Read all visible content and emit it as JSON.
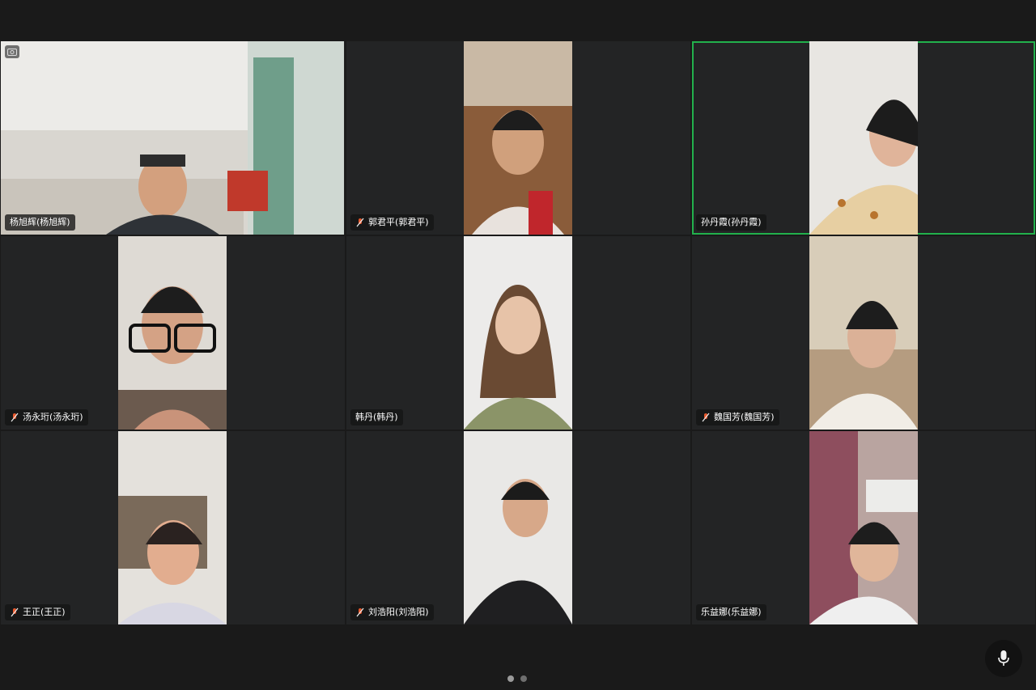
{
  "participants": [
    {
      "name": "杨旭辉(杨旭辉)",
      "muted": false,
      "active": false
    },
    {
      "name": "郭君平(郭君平)",
      "muted": true,
      "active": false
    },
    {
      "name": "孙丹霞(孙丹霞)",
      "muted": false,
      "active": true
    },
    {
      "name": "汤永珩(汤永珩)",
      "muted": true,
      "active": false
    },
    {
      "name": "韩丹(韩丹)",
      "muted": false,
      "active": false
    },
    {
      "name": "魏国芳(魏国芳)",
      "muted": true,
      "active": false
    },
    {
      "name": "王正(王正)",
      "muted": true,
      "active": false
    },
    {
      "name": "刘浩阳(刘浩阳)",
      "muted": true,
      "active": false
    },
    {
      "name": "乐益娜(乐益娜)",
      "muted": false,
      "active": false
    }
  ],
  "colors": {
    "background": "#1a1a1a",
    "tile": "#232425",
    "active_speaker": "#22b14c",
    "mic_off": "#e8582c"
  },
  "icons": {
    "camera_switch": "camera-switch-icon",
    "mic_off": "mic-off-icon",
    "microphone": "microphone-icon"
  },
  "pager": {
    "page_count": 2,
    "current_page": 1
  }
}
